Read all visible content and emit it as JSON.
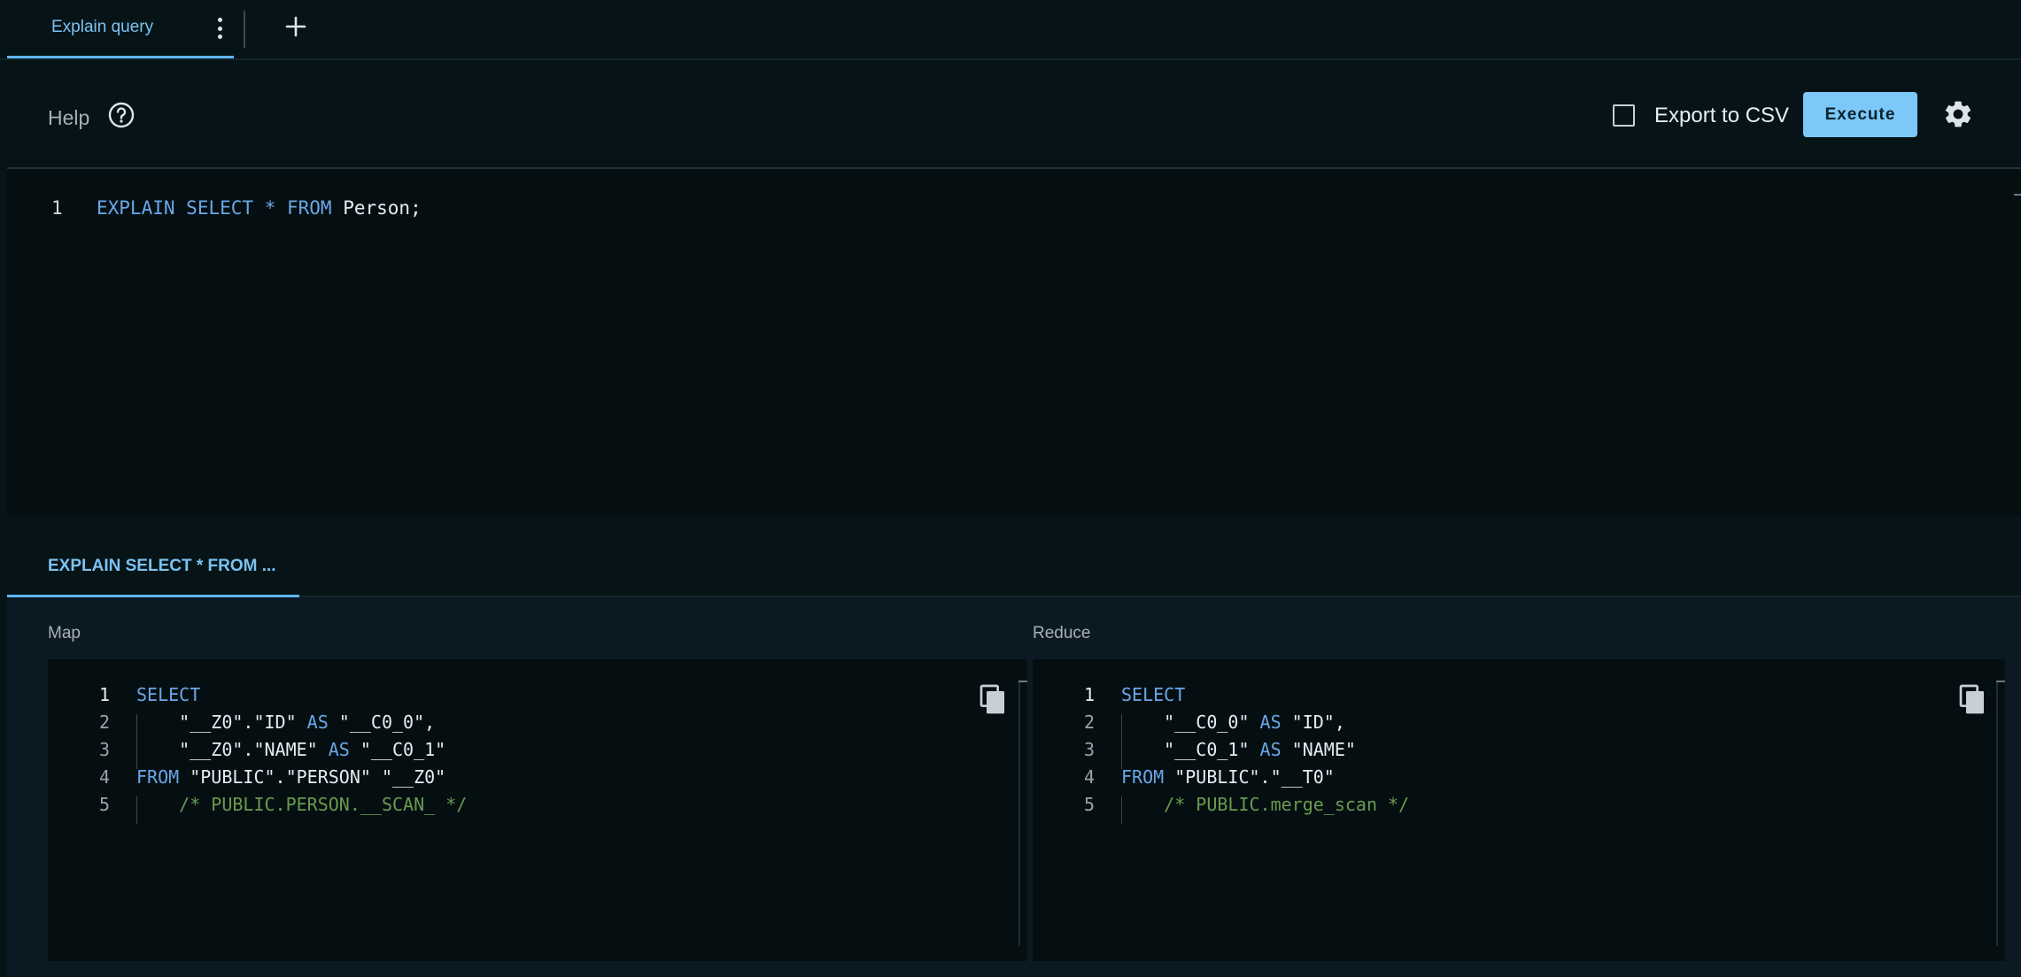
{
  "tabs": [
    {
      "label": "Explain query",
      "active": true
    }
  ],
  "toolbar": {
    "help_label": "Help",
    "export_csv_label": "Export to CSV",
    "export_csv_checked": false,
    "execute_label": "Execute"
  },
  "editor": {
    "lines": [
      {
        "number": "1",
        "tokens": [
          {
            "t": "EXPLAIN",
            "k": "kw"
          },
          {
            "t": " ",
            "k": "txt"
          },
          {
            "t": "SELECT",
            "k": "kw"
          },
          {
            "t": " ",
            "k": "txt"
          },
          {
            "t": "*",
            "k": "op"
          },
          {
            "t": " ",
            "k": "txt"
          },
          {
            "t": "FROM",
            "k": "kw"
          },
          {
            "t": " Person;",
            "k": "txt"
          }
        ]
      }
    ]
  },
  "result": {
    "tab_label": "EXPLAIN SELECT * FROM ...",
    "map": {
      "title": "Map",
      "lines": [
        {
          "number": "1",
          "tokens": [
            {
              "t": "SELECT",
              "k": "kw"
            }
          ]
        },
        {
          "number": "2",
          "tokens": [
            {
              "t": "    \"__Z0\".\"ID\" ",
              "k": "txt"
            },
            {
              "t": "AS",
              "k": "kw"
            },
            {
              "t": " \"__C0_0\",",
              "k": "txt"
            }
          ]
        },
        {
          "number": "3",
          "tokens": [
            {
              "t": "    \"__Z0\".\"NAME\" ",
              "k": "txt"
            },
            {
              "t": "AS",
              "k": "kw"
            },
            {
              "t": " \"__C0_1\"",
              "k": "txt"
            }
          ]
        },
        {
          "number": "4",
          "tokens": [
            {
              "t": "FROM",
              "k": "kw"
            },
            {
              "t": " \"PUBLIC\".\"PERSON\" \"__Z0\"",
              "k": "txt"
            }
          ]
        },
        {
          "number": "5",
          "tokens": [
            {
              "t": "    /* PUBLIC.PERSON.__SCAN_ */",
              "k": "cm"
            }
          ]
        }
      ]
    },
    "reduce": {
      "title": "Reduce",
      "lines": [
        {
          "number": "1",
          "tokens": [
            {
              "t": "SELECT",
              "k": "kw"
            }
          ]
        },
        {
          "number": "2",
          "tokens": [
            {
              "t": "    \"__C0_0\" ",
              "k": "txt"
            },
            {
              "t": "AS",
              "k": "kw"
            },
            {
              "t": " \"ID\",",
              "k": "txt"
            }
          ]
        },
        {
          "number": "3",
          "tokens": [
            {
              "t": "    \"__C0_1\" ",
              "k": "txt"
            },
            {
              "t": "AS",
              "k": "kw"
            },
            {
              "t": " \"NAME\"",
              "k": "txt"
            }
          ]
        },
        {
          "number": "4",
          "tokens": [
            {
              "t": "FROM",
              "k": "kw"
            },
            {
              "t": " \"PUBLIC\".\"__T0\"",
              "k": "txt"
            }
          ]
        },
        {
          "number": "5",
          "tokens": [
            {
              "t": "    /* PUBLIC.merge_scan */",
              "k": "cm"
            }
          ]
        }
      ]
    }
  },
  "icons": {
    "tab_menu": "more-vert-icon",
    "add_tab": "plus-icon",
    "help": "help-circle-icon",
    "settings": "gear-icon",
    "copy": "copy-icon"
  },
  "colors": {
    "accent": "#5fb6f2",
    "execute_bg": "#7cc8f8",
    "keyword": "#6aa7e8",
    "comment": "#6a9a4e",
    "background": "#061417"
  }
}
